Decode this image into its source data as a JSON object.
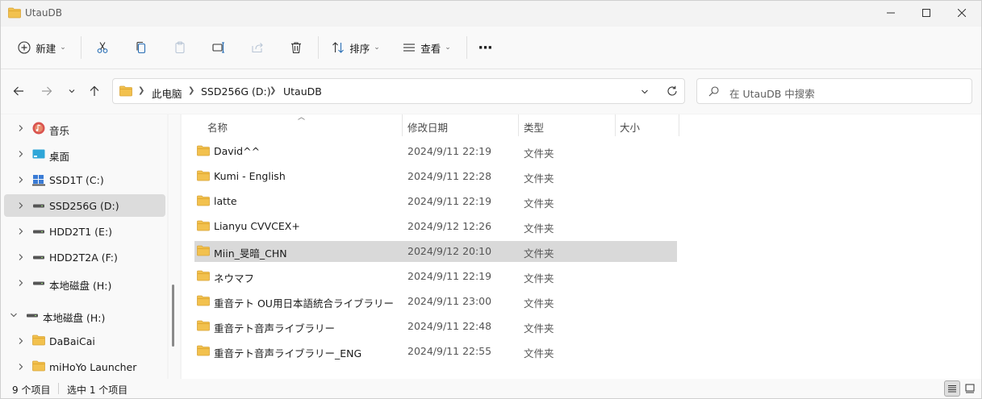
{
  "window": {
    "title": "UtauDB"
  },
  "toolbar": {
    "new_label": "新建",
    "sort_label": "排序",
    "view_label": "查看",
    "more_label": "···",
    "icons": [
      "add-circle-icon",
      "cut-icon",
      "copy-icon",
      "paste-icon",
      "rename-icon",
      "share-icon",
      "delete-icon",
      "sort-icon",
      "view-icon",
      "more-icon"
    ]
  },
  "address": {
    "crumbs": [
      "此电脑",
      "SSD256G (D:)",
      "UtauDB"
    ]
  },
  "search": {
    "placeholder": "在 UtauDB 中搜索"
  },
  "sidebar": {
    "items": [
      {
        "label": "音乐",
        "icon": "music-icon",
        "selected": false
      },
      {
        "label": "桌面",
        "icon": "desktop-icon",
        "selected": false
      },
      {
        "label": "SSD1T (C:)",
        "icon": "windows-drive-icon",
        "selected": false
      },
      {
        "label": "SSD256G (D:)",
        "icon": "drive-icon",
        "selected": true
      },
      {
        "label": "HDD2T1 (E:)",
        "icon": "drive-icon",
        "selected": false
      },
      {
        "label": "HDD2T2A (F:)",
        "icon": "drive-icon",
        "selected": false
      },
      {
        "label": "本地磁盘 (H:)",
        "icon": "drive-icon",
        "selected": false
      },
      {
        "label": "本地磁盘 (H:)",
        "icon": "drive-icon",
        "selected": false
      },
      {
        "label": "DaBaiCai",
        "icon": "folder-icon",
        "selected": false
      },
      {
        "label": "miHoYo Launcher",
        "icon": "folder-icon",
        "selected": false
      }
    ]
  },
  "columns": {
    "name": "名称",
    "date": "修改日期",
    "type": "类型",
    "size": "大小"
  },
  "files": [
    {
      "name": "David^^",
      "date": "2024/9/11 22:19",
      "type": "文件夹",
      "selected": false
    },
    {
      "name": "Kumi - English",
      "date": "2024/9/11 22:28",
      "type": "文件夹",
      "selected": false
    },
    {
      "name": "latte",
      "date": "2024/9/11 22:19",
      "type": "文件夹",
      "selected": false
    },
    {
      "name": "Lianyu CVVCEX+",
      "date": "2024/9/12 12:26",
      "type": "文件夹",
      "selected": false
    },
    {
      "name": "Miin_旻暗_CHN",
      "date": "2024/9/12 20:10",
      "type": "文件夹",
      "selected": true
    },
    {
      "name": "ネウマフ",
      "date": "2024/9/11 22:19",
      "type": "文件夹",
      "selected": false
    },
    {
      "name": "重音テト OU用日本語統合ライブラリー",
      "date": "2024/9/11 23:00",
      "type": "文件夹",
      "selected": false
    },
    {
      "name": "重音テト音声ライブラリー",
      "date": "2024/9/11 22:48",
      "type": "文件夹",
      "selected": false
    },
    {
      "name": "重音テト音声ライブラリー_ENG",
      "date": "2024/9/11 22:55",
      "type": "文件夹",
      "selected": false
    }
  ],
  "status": {
    "count": "9 个项目",
    "selection": "选中 1 个项目"
  },
  "colors": {
    "folder": "#f2c14e",
    "folder_dark": "#e0a82e",
    "selected_row": "#d9d9d9",
    "accent": "#0067c0"
  }
}
